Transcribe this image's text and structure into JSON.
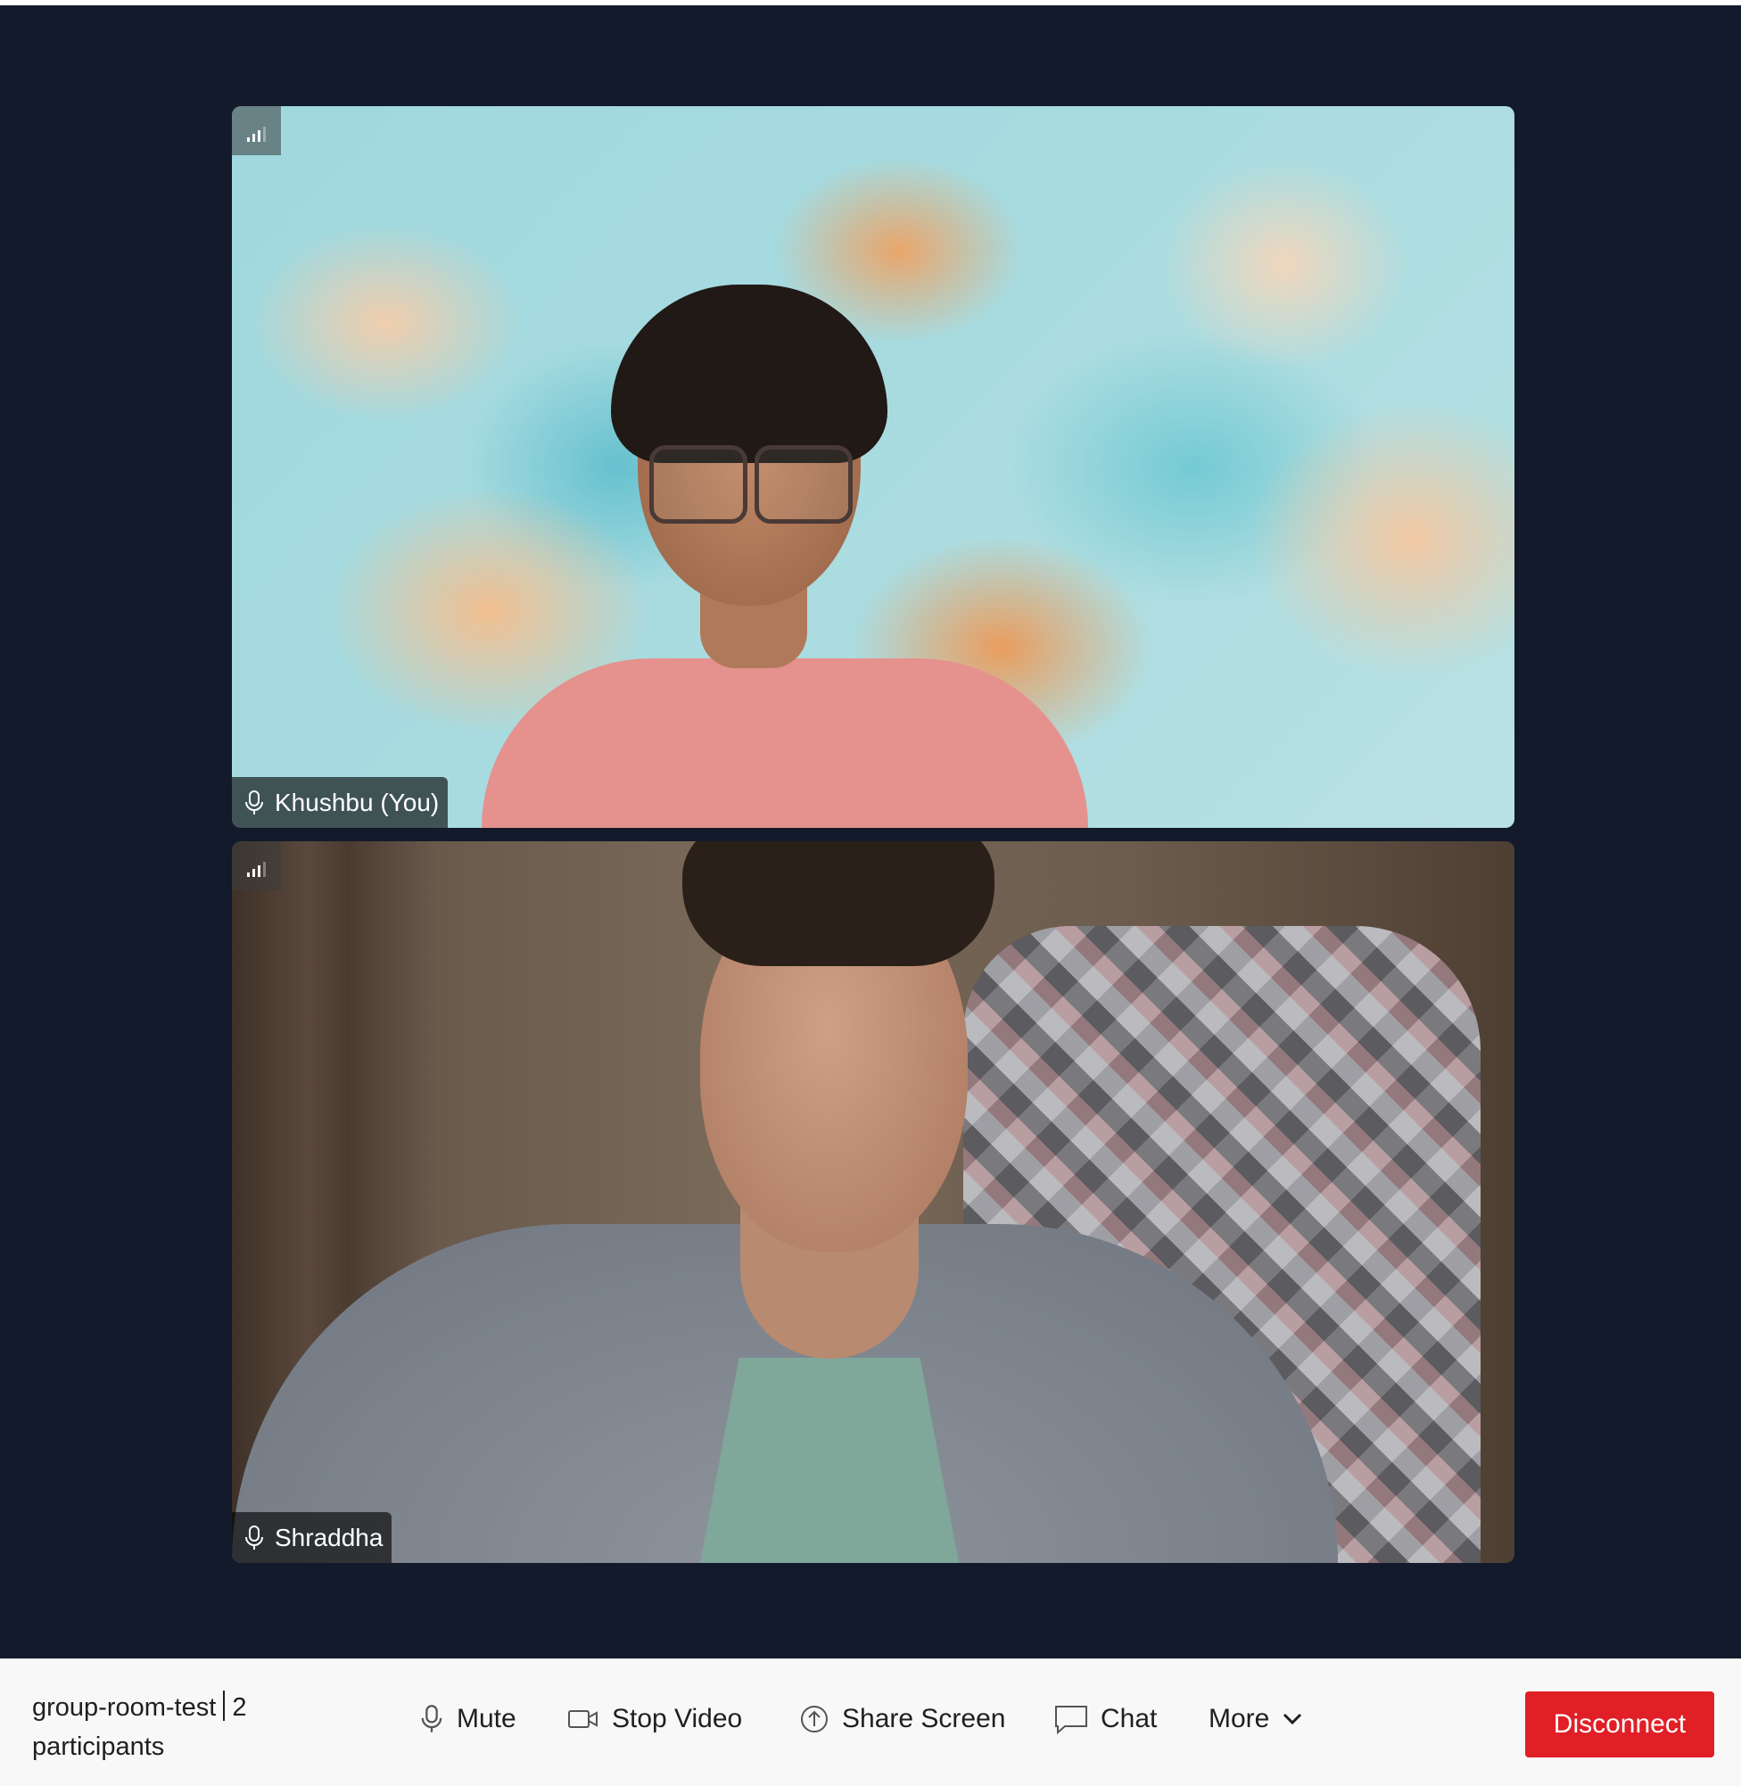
{
  "participants": [
    {
      "name": "Khushbu (You)"
    },
    {
      "name": "Shraddha"
    }
  ],
  "toolbar": {
    "room_name": "group-room-test",
    "participant_count": "2",
    "participant_label": "participants",
    "mute_label": "Mute",
    "stop_video_label": "Stop Video",
    "share_screen_label": "Share Screen",
    "chat_label": "Chat",
    "more_label": "More",
    "disconnect_label": "Disconnect"
  },
  "colors": {
    "stage_background": "#131a2b",
    "toolbar_background": "#f8f8f8",
    "disconnect": "#e01f26"
  },
  "icons": {
    "network_quality": "signal-bars-icon",
    "participant_audio": "microphone-icon",
    "mute": "microphone-icon",
    "stop_video": "video-camera-icon",
    "share_screen": "upload-arrow-icon",
    "chat": "chat-bubble-icon",
    "more": "chevron-down-icon"
  }
}
